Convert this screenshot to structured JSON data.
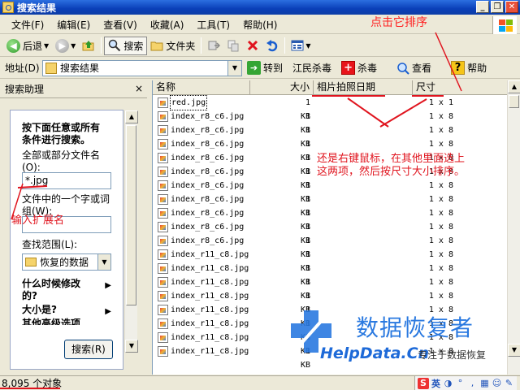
{
  "window": {
    "title": "搜索结果",
    "controls": {
      "minimize": "_",
      "restore": "❐",
      "close": "✕"
    }
  },
  "menu": [
    "文件(F)",
    "编辑(E)",
    "查看(V)",
    "收藏(A)",
    "工具(T)",
    "帮助(H)"
  ],
  "toolbar": {
    "back": "后退",
    "search": "搜索",
    "folders": "文件夹"
  },
  "address": {
    "label": "地址(D)",
    "value": "搜索结果",
    "go": "转到",
    "links": [
      "江民杀毒",
      "杀毒",
      "查看",
      "帮助"
    ]
  },
  "search_pane": {
    "title": "搜索助理",
    "close": "×",
    "heading": [
      "按下面任意或所有",
      "条件进行搜索。"
    ],
    "filename_label": [
      "全部或部分文件名",
      "(O):"
    ],
    "filename_value": "*.jpg",
    "phrase_label": [
      "文件中的一个字或词",
      "组(W):"
    ],
    "phrase_value": "",
    "lookin_label": "查找范围(L):",
    "lookin_value": "恢复的数据",
    "options": [
      "什么时候修改",
      "的?",
      "大小是?",
      "其他高级选项"
    ],
    "search_button": "搜索(R)"
  },
  "file_list": {
    "columns": [
      "名称",
      "大小",
      "相片拍照日期",
      "尺寸"
    ],
    "rows": [
      {
        "name": "red.jpg",
        "size": "1 KB",
        "dims": "1 x 1"
      },
      {
        "name": "index_r8_c6.jpg",
        "size": "1 KB",
        "dims": "1 x 8"
      },
      {
        "name": "index_r8_c6.jpg",
        "size": "1 KB",
        "dims": "1 x 8"
      },
      {
        "name": "index_r8_c6.jpg",
        "size": "1 KB",
        "dims": "1 x 8"
      },
      {
        "name": "index_r8_c6.jpg",
        "size": "1 KB",
        "dims": "1 x 8"
      },
      {
        "name": "index_r8_c6.jpg",
        "size": "1 KB",
        "dims": "1 x 8"
      },
      {
        "name": "index_r8_c6.jpg",
        "size": "1 KB",
        "dims": "1 x 8"
      },
      {
        "name": "index_r8_c6.jpg",
        "size": "1 KB",
        "dims": "1 x 8"
      },
      {
        "name": "index_r8_c6.jpg",
        "size": "1 KB",
        "dims": "1 x 8"
      },
      {
        "name": "index_r8_c6.jpg",
        "size": "1 KB",
        "dims": "1 x 8"
      },
      {
        "name": "index_r8_c6.jpg",
        "size": "1 KB",
        "dims": "1 x 8"
      },
      {
        "name": "index_r11_c8.jpg",
        "size": "1 KB",
        "dims": "1 x 8"
      },
      {
        "name": "index_r11_c8.jpg",
        "size": "1 KB",
        "dims": "1 x 8"
      },
      {
        "name": "index_r11_c8.jpg",
        "size": "1 KB",
        "dims": "1 x 8"
      },
      {
        "name": "index_r11_c8.jpg",
        "size": "1 KB",
        "dims": "1 x 8"
      },
      {
        "name": "index_r11_c8.jpg",
        "size": "1 KB",
        "dims": "1 x 8"
      },
      {
        "name": "index_r11_c8.jpg",
        "size": "1 KB",
        "dims": "1 x 8"
      },
      {
        "name": "index_r11_c8.jpg",
        "size": "1 KB",
        "dims": "1 x 8"
      },
      {
        "name": "index_r11_c8.jpg",
        "size": "1 KB",
        "dims": "1 x 8"
      }
    ]
  },
  "status": {
    "count": "8,095 个对象",
    "ime": {
      "logo": "S",
      "mode": "英"
    }
  },
  "annotations": {
    "sort_hint": "点击它排序",
    "right_click_hint": [
      "还是右键鼠标，在其他里面选上",
      "这两项，然后按尺寸大小排序。"
    ],
    "ext_hint": "输入扩展名"
  },
  "watermark": {
    "title": "数据恢复者",
    "site": "HelpData.Cn",
    "slogan": "专注于数据恢复"
  },
  "colors": {
    "title_bar": "#0a3fb8",
    "annotation_red": "#e0141e",
    "watermark_blue": "#2a79e0"
  }
}
